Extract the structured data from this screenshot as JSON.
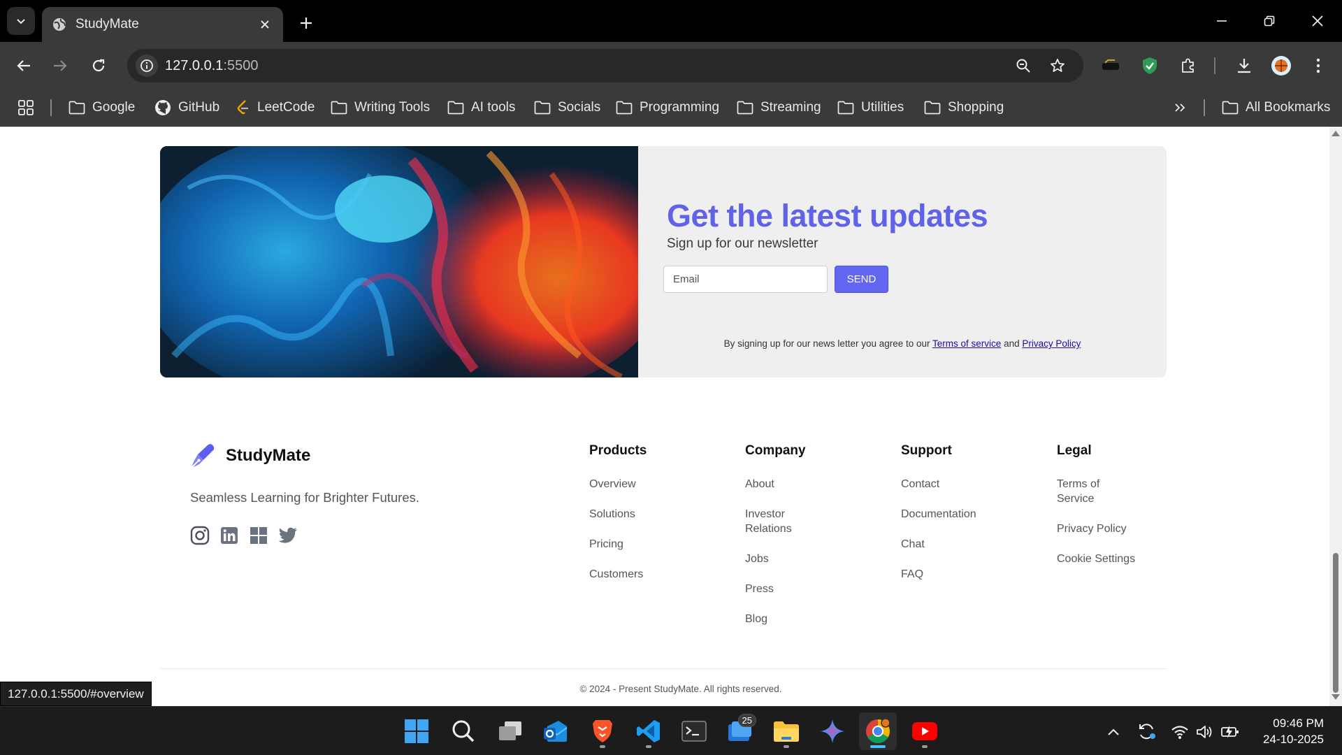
{
  "browser": {
    "tab_title": "StudyMate",
    "url_host": "127.0.0.1",
    "url_port": ":5500",
    "status_url": "127.0.0.1:5500/#overview"
  },
  "bookmarks": [
    {
      "label": "Google",
      "icon": "folder-icon"
    },
    {
      "label": "GitHub",
      "icon": "github-icon"
    },
    {
      "label": "LeetCode",
      "icon": "leetcode-icon"
    },
    {
      "label": "Writing Tools",
      "icon": "folder-icon"
    },
    {
      "label": "AI tools",
      "icon": "folder-icon"
    },
    {
      "label": "Socials",
      "icon": "folder-icon"
    },
    {
      "label": "Programming",
      "icon": "folder-icon"
    },
    {
      "label": "Streaming",
      "icon": "folder-icon"
    },
    {
      "label": "Utilities",
      "icon": "folder-icon"
    },
    {
      "label": "Shopping",
      "icon": "folder-icon"
    }
  ],
  "all_bookmarks_label": "All Bookmarks",
  "newsletter": {
    "title": "Get the latest updates",
    "subtitle": "Sign up for our newsletter",
    "email_placeholder": "Email",
    "send_label": "SEND",
    "terms_prefix": "By signing up for our news letter you agree to our",
    "terms_link": "Terms of service",
    "terms_and": "and",
    "privacy_link": "Privacy Policy",
    "title_color": "#6063e6",
    "button_color": "#6366f1"
  },
  "footer": {
    "brand": "StudyMate",
    "tagline": "Seamless Learning for Brighter Futures.",
    "socials": [
      "instagram-icon",
      "linkedin-icon",
      "windows-icon",
      "twitter-icon"
    ],
    "columns": [
      {
        "heading": "Products",
        "links": [
          "Overview",
          "Solutions",
          "Pricing",
          "Customers"
        ]
      },
      {
        "heading": "Company",
        "links": [
          "About",
          "Investor Relations",
          "Jobs",
          "Press",
          "Blog"
        ]
      },
      {
        "heading": "Support",
        "links": [
          "Contact",
          "Documentation",
          "Chat",
          "FAQ"
        ]
      },
      {
        "heading": "Legal",
        "links": [
          "Terms of Service",
          "Privacy Policy",
          "Cookie Settings"
        ]
      }
    ],
    "copyright": "© 2024 - Present StudyMate. All rights reserved."
  },
  "taskbar": {
    "mail_badge": "25",
    "time": "09:46 PM",
    "date": "24-10-2025"
  }
}
